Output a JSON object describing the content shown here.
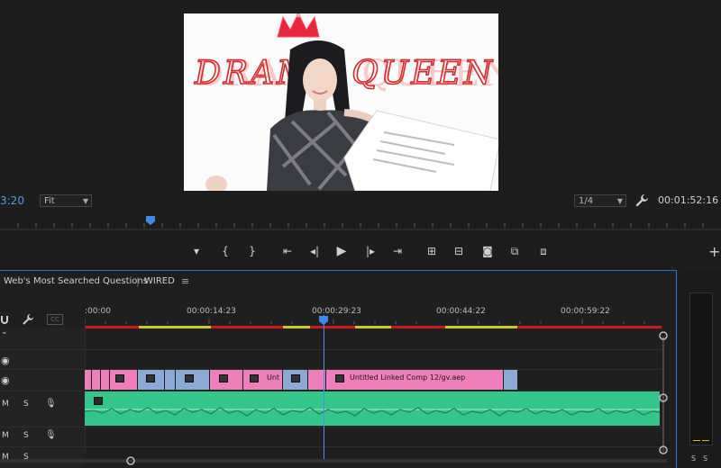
{
  "monitor": {
    "timecode": "3:20",
    "zoom": "Fit",
    "resolution": "1/4",
    "duration": "00:01:52:16",
    "preview_title": "DRAMA QUEEN"
  },
  "transport": {
    "icons": [
      "add-marker-icon",
      "mark-in-icon",
      "mark-out-icon",
      "go-to-in-icon",
      "step-back-icon",
      "play-icon",
      "step-forward-icon",
      "go-to-out-icon",
      "lift-icon",
      "extract-icon",
      "export-frame-icon",
      "insert-icon",
      "overwrite-icon"
    ],
    "add_label": "+"
  },
  "sequence": {
    "name": "Web's Most Searched Questions",
    "channel": "WIRED",
    "menu": "≡"
  },
  "ruler": {
    "ticks": [
      ":00:00",
      "00:00:14:23",
      "00:00:29:23",
      "00:00:44:22",
      "00:00:59:22"
    ]
  },
  "tracks": {
    "video_clip_label_short": "Unt",
    "video_clip_label": "Untitled Linked Comp 12/gv.aep",
    "mute_label": "M",
    "solo_label": "S"
  },
  "meters": {
    "s_left": "S",
    "s_right": "S"
  },
  "colors": {
    "accent": "#2b6fd8",
    "timecode": "#4a9df0",
    "clip_pink": "#ee7fba",
    "clip_blue": "#8aa9d4",
    "audio_green": "#34c58a"
  }
}
